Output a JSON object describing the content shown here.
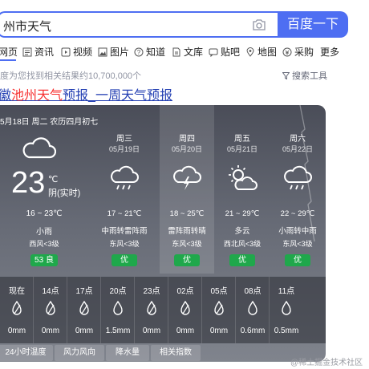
{
  "search": {
    "query": "州市天气",
    "button_label": "百度一下"
  },
  "tabs": [
    {
      "label": "网页",
      "icon": "none"
    },
    {
      "label": "资讯",
      "icon": "news-icon"
    },
    {
      "label": "视频",
      "icon": "video-icon"
    },
    {
      "label": "图片",
      "icon": "image-icon"
    },
    {
      "label": "知道",
      "icon": "question-icon"
    },
    {
      "label": "文库",
      "icon": "doc-icon"
    },
    {
      "label": "贴吧",
      "icon": "tieba-icon"
    },
    {
      "label": "地图",
      "icon": "map-icon"
    },
    {
      "label": "采购",
      "icon": "purchase-icon"
    },
    {
      "label": "更多",
      "icon": "none"
    }
  ],
  "results": {
    "count_text": "度为您找到相关结果约10,700,000个",
    "tools_label": "搜索工具",
    "title_prefix": "徽",
    "title_hl": "池州天气",
    "title_mid": "预报_",
    "title_suffix": "一周天气预报"
  },
  "weather": {
    "date_line": "5月18日 周二 农历四月初七",
    "today": {
      "temp": "23",
      "unit": "℃",
      "live_label": "阴(实时)",
      "range": "16 ~ 23℃",
      "condition": "小雨",
      "wind": "西风<3级",
      "aqi": "53 良",
      "icon": "cloud-icon"
    },
    "days": [
      {
        "name": "周三",
        "date": "05月19日",
        "icon": "rain-cloud-icon",
        "range": "17 ~ 21℃",
        "condition": "中雨转雷阵雨",
        "wind": "东风<3级",
        "aqi": "优"
      },
      {
        "name": "周四",
        "date": "05月20日",
        "icon": "thunder-cloud-icon",
        "range": "18 ~ 25℃",
        "condition": "雷阵雨转晴",
        "wind": "东风<3级",
        "aqi": "优"
      },
      {
        "name": "周五",
        "date": "05月21日",
        "icon": "partly-cloudy-icon",
        "range": "21 ~ 29℃",
        "condition": "多云",
        "wind": "西北风<3级",
        "aqi": "优"
      },
      {
        "name": "周六",
        "date": "05月22日",
        "icon": "rain-cloud-icon",
        "range": "22 ~ 29℃",
        "condition": "小雨转中雨",
        "wind": "东风<3级",
        "aqi": "优"
      }
    ],
    "hours": [
      {
        "time": "现在",
        "value": "0mm"
      },
      {
        "time": "14点",
        "value": "0mm"
      },
      {
        "time": "17点",
        "value": "0mm"
      },
      {
        "time": "20点",
        "value": "1.5mm"
      },
      {
        "time": "23点",
        "value": "0mm"
      },
      {
        "time": "02点",
        "value": "0mm"
      },
      {
        "time": "05点",
        "value": "0mm"
      },
      {
        "time": "08点",
        "value": "0.6mm"
      },
      {
        "time": "11点",
        "value": "0.5mm"
      }
    ],
    "bottom_tabs": [
      "24小时温度",
      "风力风向",
      "降水量",
      "相关指数"
    ]
  },
  "watermark": "@稀土掘金技术社区",
  "colors": {
    "accent": "#4e6ef2",
    "link": "#2440b3",
    "highlight": "#f73131",
    "aqi_green": "#1fa84b"
  }
}
